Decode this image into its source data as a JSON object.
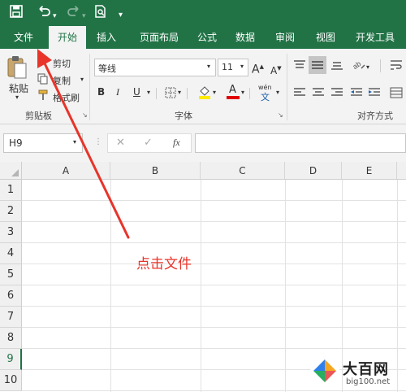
{
  "quick_access": {
    "save_icon": "save-icon",
    "undo_icon": "undo-icon",
    "redo_icon": "redo-icon",
    "print_preview_icon": "print-preview-icon",
    "customize_icon": "customize-icon"
  },
  "tabs": [
    "文件",
    "开始",
    "插入",
    "页面布局",
    "公式",
    "数据",
    "审阅",
    "视图",
    "开发工具"
  ],
  "ribbon": {
    "clipboard": {
      "paste": "粘贴",
      "cut": "剪切",
      "copy": "复制",
      "format_painter": "格式刷",
      "group_label": "剪贴板"
    },
    "font": {
      "font_name": "等线",
      "font_size": "11",
      "bold": "B",
      "italic": "I",
      "underline": "U",
      "increase_font": "A",
      "decrease_font": "A",
      "phonetic": "wén",
      "phonetic_char": "文",
      "font_color_letter": "A",
      "group_label": "字体"
    },
    "alignment": {
      "group_label": "对齐方式"
    }
  },
  "formula_bar": {
    "name_box": "H9",
    "cancel": "✕",
    "enter": "✓",
    "fx": "fx",
    "value": ""
  },
  "grid": {
    "columns": [
      "A",
      "B",
      "C",
      "D",
      "E"
    ],
    "rows": [
      "1",
      "2",
      "3",
      "4",
      "5",
      "6",
      "7",
      "8",
      "9",
      "10"
    ],
    "selected_row": "9"
  },
  "annotation": {
    "text": "点击文件",
    "color": "#e8342a"
  },
  "watermark": {
    "brand": "大百网",
    "url": "big100.net"
  }
}
